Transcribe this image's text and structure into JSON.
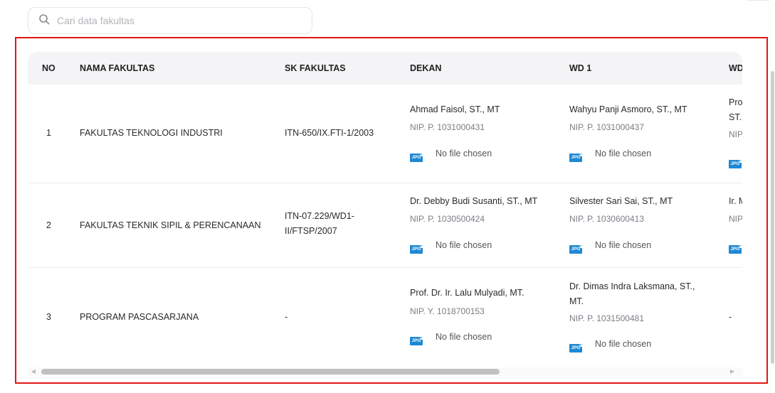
{
  "search": {
    "placeholder": "Cari data fakultas",
    "icon": "search-icon"
  },
  "table": {
    "headers": [
      "NO",
      "NAMA FAKULTAS",
      "SK FAKULTAS",
      "DEKAN",
      "WD 1",
      "WD"
    ],
    "rows": [
      {
        "no": "1",
        "nama": "FAKULTAS TEKNOLOGI INDUSTRI",
        "sk": "ITN-650/IX.FTI-1/2003",
        "dekan": {
          "name": "Ahmad Faisol, ST., MT",
          "nip": "NIP. P. 1031000431",
          "file": "No file chosen"
        },
        "wd1": {
          "name": "Wahyu Panji Asmoro, ST., MT",
          "nip": "NIP. P. 1031000437",
          "file": "No file chosen"
        },
        "wd2": {
          "name_line1": "Pro",
          "name_line2": "ST.",
          "nip": "NIP"
        }
      },
      {
        "no": "2",
        "nama": "FAKULTAS TEKNIK SIPIL & PERENCANAAN",
        "sk": "ITN-07.229/WD1-II/FTSP/2007",
        "dekan": {
          "name": "Dr. Debby Budi Susanti, ST., MT",
          "nip": "NIP. P. 1030500424",
          "file": "No file chosen"
        },
        "wd1": {
          "name": "Silvester Sari Sai, ST., MT",
          "nip": "NIP. P. 1030600413",
          "file": "No file chosen"
        },
        "wd2": {
          "name_line1": "Ir. M",
          "nip": "NIP"
        }
      },
      {
        "no": "3",
        "nama": "PROGRAM PASCASARJANA",
        "sk": "-",
        "dekan": {
          "name": "Prof. Dr. Ir. Lalu Mulyadi, MT.",
          "nip": "NIP. Y. 1018700153",
          "file": "No file chosen"
        },
        "wd1": {
          "name": "Dr. Dimas Indra Laksmana, ST., MT.",
          "nip": "NIP. P. 1031500481",
          "file": "No file chosen"
        },
        "wd2": {
          "name_line1": "-"
        }
      }
    ],
    "file_badge": "JPG"
  },
  "colors": {
    "highlight": "#e01616",
    "badge": "#1e88d4",
    "header_bg": "#f4f4f6"
  }
}
